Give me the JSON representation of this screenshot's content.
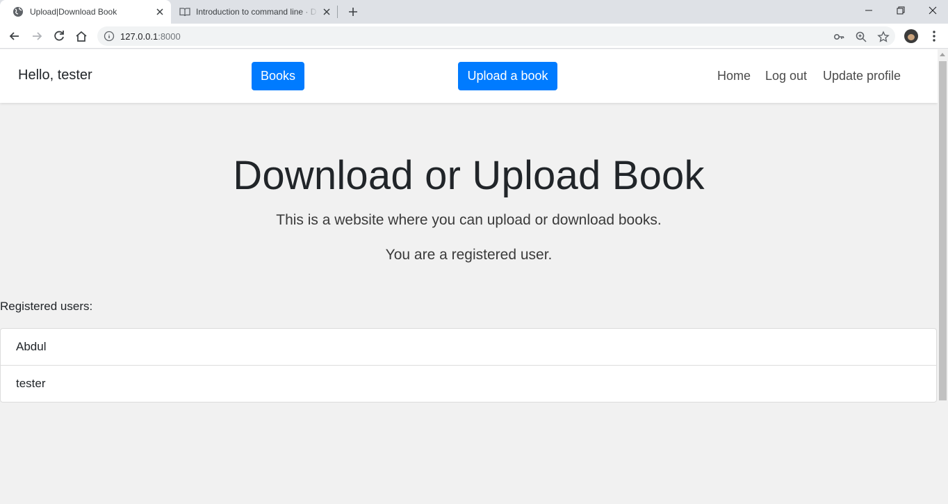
{
  "browser": {
    "tabs": [
      {
        "title": "Upload|Download Book",
        "active": true,
        "favicon": "globe-icon"
      },
      {
        "title": "Introduction to command line · D",
        "active": false,
        "favicon": "book-icon"
      }
    ],
    "url_host": "127.0.0.1",
    "url_port": ":8000"
  },
  "navbar": {
    "greeting": "Hello, tester",
    "books_button": "Books",
    "upload_button": "Upload a book",
    "links": {
      "home": "Home",
      "logout": "Log out",
      "update_profile": "Update profile"
    }
  },
  "hero": {
    "title": "Download or Upload Book",
    "lead": "This is a website where you can upload or download books.",
    "status": "You are a registered user."
  },
  "users": {
    "heading": "Registered users:",
    "items": [
      "Abdul",
      "tester"
    ]
  },
  "colors": {
    "primary": "#007bff",
    "page_bg": "#f1f1f1",
    "navbar_bg": "#ffffff"
  }
}
